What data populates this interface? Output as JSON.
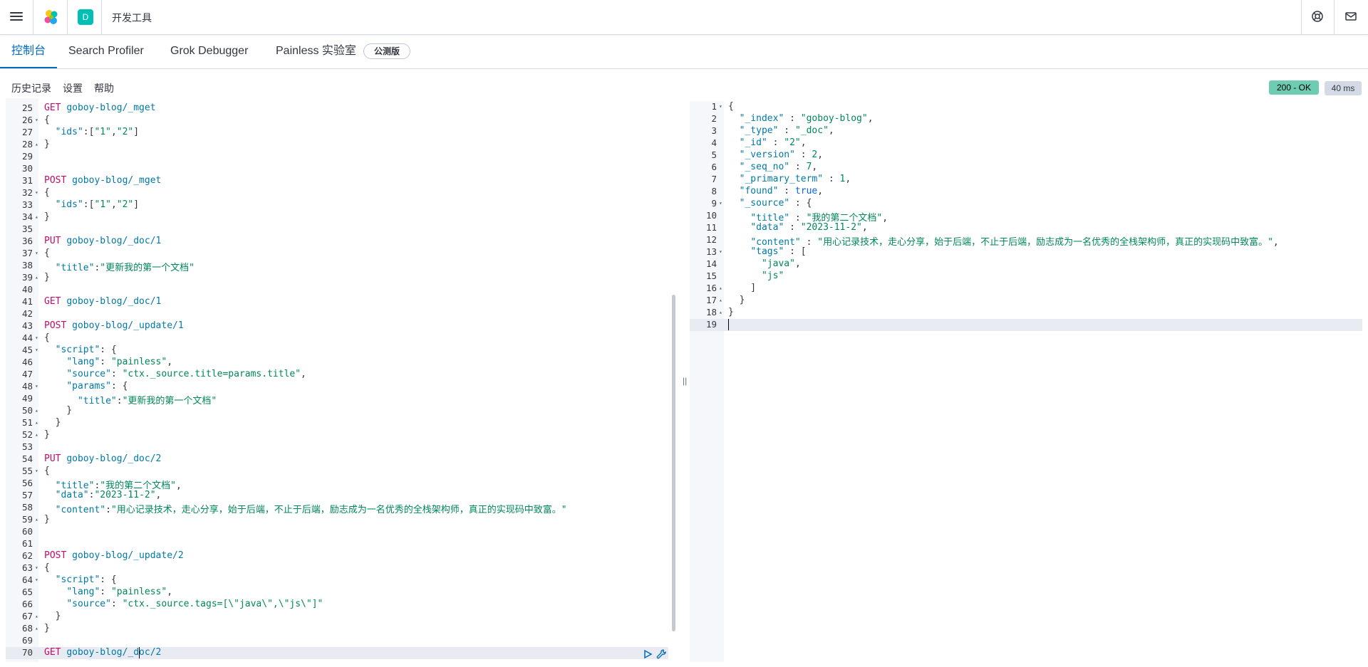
{
  "header": {
    "space_letter": "D",
    "title": "开发工具",
    "logo_icon": "elastic-logo-icon",
    "help_icon": "help-icon",
    "mail_icon": "newsfeed-icon"
  },
  "tabs": [
    {
      "label": "控制台",
      "active": true
    },
    {
      "label": "Search Profiler"
    },
    {
      "label": "Grok Debugger"
    },
    {
      "label": "Painless 实验室"
    }
  ],
  "beta_badge": "公测版",
  "toolbar": {
    "history": "历史记录",
    "settings": "设置",
    "help": "帮助"
  },
  "status": {
    "code": "200 - OK",
    "time": "40 ms",
    "color": "#6dccb1"
  },
  "request_lines": [
    {
      "n": "25",
      "fold": "",
      "tokens": [
        [
          "m",
          "GET "
        ],
        [
          "u",
          "goboy-blog/_mget"
        ]
      ]
    },
    {
      "n": "26",
      "fold": "open",
      "tokens": [
        [
          "p",
          "{"
        ]
      ]
    },
    {
      "n": "27",
      "fold": "",
      "tokens": [
        [
          "p",
          "  "
        ],
        [
          "k",
          "\"ids\""
        ],
        [
          "p",
          ":["
        ],
        [
          "s",
          "\"1\""
        ],
        [
          "p",
          ","
        ],
        [
          "s",
          "\"2\""
        ],
        [
          "p",
          "]"
        ]
      ]
    },
    {
      "n": "28",
      "fold": "close",
      "tokens": [
        [
          "p",
          "}"
        ]
      ]
    },
    {
      "n": "29",
      "fold": "",
      "tokens": []
    },
    {
      "n": "30",
      "fold": "",
      "tokens": []
    },
    {
      "n": "31",
      "fold": "",
      "tokens": [
        [
          "m",
          "POST "
        ],
        [
          "u",
          "goboy-blog/_mget"
        ]
      ]
    },
    {
      "n": "32",
      "fold": "open",
      "tokens": [
        [
          "p",
          "{"
        ]
      ]
    },
    {
      "n": "33",
      "fold": "",
      "tokens": [
        [
          "p",
          "  "
        ],
        [
          "k",
          "\"ids\""
        ],
        [
          "p",
          ":["
        ],
        [
          "s",
          "\"1\""
        ],
        [
          "p",
          ","
        ],
        [
          "s",
          "\"2\""
        ],
        [
          "p",
          "]"
        ]
      ]
    },
    {
      "n": "34",
      "fold": "close",
      "tokens": [
        [
          "p",
          "}"
        ]
      ]
    },
    {
      "n": "35",
      "fold": "",
      "tokens": []
    },
    {
      "n": "36",
      "fold": "",
      "tokens": [
        [
          "m",
          "PUT "
        ],
        [
          "u",
          "goboy-blog/_doc/1"
        ]
      ]
    },
    {
      "n": "37",
      "fold": "open",
      "tokens": [
        [
          "p",
          "{"
        ]
      ]
    },
    {
      "n": "38",
      "fold": "",
      "tokens": [
        [
          "p",
          "  "
        ],
        [
          "k",
          "\"title\""
        ],
        [
          "p",
          ":"
        ],
        [
          "s",
          "\"更新我的第一个文档\""
        ]
      ]
    },
    {
      "n": "39",
      "fold": "close",
      "tokens": [
        [
          "p",
          "}"
        ]
      ]
    },
    {
      "n": "40",
      "fold": "",
      "tokens": []
    },
    {
      "n": "41",
      "fold": "",
      "tokens": [
        [
          "m",
          "GET "
        ],
        [
          "u",
          "goboy-blog/_doc/1"
        ]
      ]
    },
    {
      "n": "42",
      "fold": "",
      "tokens": []
    },
    {
      "n": "43",
      "fold": "",
      "tokens": [
        [
          "m",
          "POST "
        ],
        [
          "u",
          "goboy-blog/_update/1"
        ]
      ]
    },
    {
      "n": "44",
      "fold": "open",
      "tokens": [
        [
          "p",
          "{"
        ]
      ]
    },
    {
      "n": "45",
      "fold": "open",
      "tokens": [
        [
          "p",
          "  "
        ],
        [
          "k",
          "\"script\""
        ],
        [
          "p",
          ": {"
        ]
      ]
    },
    {
      "n": "46",
      "fold": "",
      "tokens": [
        [
          "p",
          "    "
        ],
        [
          "k",
          "\"lang\""
        ],
        [
          "p",
          ": "
        ],
        [
          "s",
          "\"painless\""
        ],
        [
          "p",
          ","
        ]
      ]
    },
    {
      "n": "47",
      "fold": "",
      "tokens": [
        [
          "p",
          "    "
        ],
        [
          "k",
          "\"source\""
        ],
        [
          "p",
          ": "
        ],
        [
          "s",
          "\"ctx._source.title=params.title\""
        ],
        [
          "p",
          ","
        ]
      ]
    },
    {
      "n": "48",
      "fold": "open",
      "tokens": [
        [
          "p",
          "    "
        ],
        [
          "k",
          "\"params\""
        ],
        [
          "p",
          ": {"
        ]
      ]
    },
    {
      "n": "49",
      "fold": "",
      "tokens": [
        [
          "p",
          "      "
        ],
        [
          "k",
          "\"title\""
        ],
        [
          "p",
          ":"
        ],
        [
          "s",
          "\"更新我的第一个文档\""
        ]
      ]
    },
    {
      "n": "50",
      "fold": "close",
      "tokens": [
        [
          "p",
          "    }"
        ]
      ]
    },
    {
      "n": "51",
      "fold": "close",
      "tokens": [
        [
          "p",
          "  }"
        ]
      ]
    },
    {
      "n": "52",
      "fold": "close",
      "tokens": [
        [
          "p",
          "}"
        ]
      ]
    },
    {
      "n": "53",
      "fold": "",
      "tokens": []
    },
    {
      "n": "54",
      "fold": "",
      "tokens": [
        [
          "m",
          "PUT "
        ],
        [
          "u",
          "goboy-blog/_doc/2"
        ]
      ]
    },
    {
      "n": "55",
      "fold": "open",
      "tokens": [
        [
          "p",
          "{"
        ]
      ]
    },
    {
      "n": "56",
      "fold": "",
      "tokens": [
        [
          "p",
          "  "
        ],
        [
          "k",
          "\"title\""
        ],
        [
          "p",
          ":"
        ],
        [
          "s",
          "\"我的第二个文档\""
        ],
        [
          "p",
          ","
        ]
      ]
    },
    {
      "n": "57",
      "fold": "",
      "tokens": [
        [
          "p",
          "  "
        ],
        [
          "k",
          "\"data\""
        ],
        [
          "p",
          ":"
        ],
        [
          "s",
          "\"2023-11-2\""
        ],
        [
          "p",
          ","
        ]
      ]
    },
    {
      "n": "58",
      "fold": "",
      "tokens": [
        [
          "p",
          "  "
        ],
        [
          "k",
          "\"content\""
        ],
        [
          "p",
          ":"
        ],
        [
          "s",
          "\"用心记录技术，走心分享，始于后端，不止于后端，励志成为一名优秀的全栈架构师，真正的实现码中致富。\""
        ]
      ]
    },
    {
      "n": "59",
      "fold": "close",
      "tokens": [
        [
          "p",
          "}"
        ]
      ]
    },
    {
      "n": "60",
      "fold": "",
      "tokens": []
    },
    {
      "n": "61",
      "fold": "",
      "tokens": []
    },
    {
      "n": "62",
      "fold": "",
      "tokens": [
        [
          "m",
          "POST "
        ],
        [
          "u",
          "goboy-blog/_update/2"
        ]
      ]
    },
    {
      "n": "63",
      "fold": "open",
      "tokens": [
        [
          "p",
          "{"
        ]
      ]
    },
    {
      "n": "64",
      "fold": "open",
      "tokens": [
        [
          "p",
          "  "
        ],
        [
          "k",
          "\"script\""
        ],
        [
          "p",
          ": {"
        ]
      ]
    },
    {
      "n": "65",
      "fold": "",
      "tokens": [
        [
          "p",
          "    "
        ],
        [
          "k",
          "\"lang\""
        ],
        [
          "p",
          ": "
        ],
        [
          "s",
          "\"painless\""
        ],
        [
          "p",
          ","
        ]
      ]
    },
    {
      "n": "66",
      "fold": "",
      "tokens": [
        [
          "p",
          "    "
        ],
        [
          "k",
          "\"source\""
        ],
        [
          "p",
          ": "
        ],
        [
          "s",
          "\"ctx._source.tags=[\\\"java\\\",\\\"js\\\"]\""
        ]
      ]
    },
    {
      "n": "67",
      "fold": "close",
      "tokens": [
        [
          "p",
          "  }"
        ]
      ]
    },
    {
      "n": "68",
      "fold": "close",
      "tokens": [
        [
          "p",
          "}"
        ]
      ]
    },
    {
      "n": "69",
      "fold": "",
      "tokens": []
    },
    {
      "n": "70",
      "fold": "",
      "tokens": [
        [
          "m",
          "GET "
        ],
        [
          "u",
          "goboy-blog/_doc/2"
        ]
      ]
    }
  ],
  "response_lines": [
    {
      "n": "1",
      "fold": "open",
      "tokens": [
        [
          "p",
          "{"
        ]
      ]
    },
    {
      "n": "2",
      "fold": "",
      "tokens": [
        [
          "p",
          "  "
        ],
        [
          "k",
          "\"_index\""
        ],
        [
          "p",
          " : "
        ],
        [
          "s",
          "\"goboy-blog\""
        ],
        [
          "p",
          ","
        ]
      ]
    },
    {
      "n": "3",
      "fold": "",
      "tokens": [
        [
          "p",
          "  "
        ],
        [
          "k",
          "\"_type\""
        ],
        [
          "p",
          " : "
        ],
        [
          "s",
          "\"_doc\""
        ],
        [
          "p",
          ","
        ]
      ]
    },
    {
      "n": "4",
      "fold": "",
      "tokens": [
        [
          "p",
          "  "
        ],
        [
          "k",
          "\"_id\""
        ],
        [
          "p",
          " : "
        ],
        [
          "s",
          "\"2\""
        ],
        [
          "p",
          ","
        ]
      ]
    },
    {
      "n": "5",
      "fold": "",
      "tokens": [
        [
          "p",
          "  "
        ],
        [
          "k",
          "\"_version\""
        ],
        [
          "p",
          " : "
        ],
        [
          "n",
          "2"
        ],
        [
          "p",
          ","
        ]
      ]
    },
    {
      "n": "6",
      "fold": "",
      "tokens": [
        [
          "p",
          "  "
        ],
        [
          "k",
          "\"_seq_no\""
        ],
        [
          "p",
          " : "
        ],
        [
          "n",
          "7"
        ],
        [
          "p",
          ","
        ]
      ]
    },
    {
      "n": "7",
      "fold": "",
      "tokens": [
        [
          "p",
          "  "
        ],
        [
          "k",
          "\"_primary_term\""
        ],
        [
          "p",
          " : "
        ],
        [
          "n",
          "1"
        ],
        [
          "p",
          ","
        ]
      ]
    },
    {
      "n": "8",
      "fold": "",
      "tokens": [
        [
          "p",
          "  "
        ],
        [
          "k",
          "\"found\""
        ],
        [
          "p",
          " : "
        ],
        [
          "b",
          "true"
        ],
        [
          "p",
          ","
        ]
      ]
    },
    {
      "n": "9",
      "fold": "open",
      "tokens": [
        [
          "p",
          "  "
        ],
        [
          "k",
          "\"_source\""
        ],
        [
          "p",
          " : {"
        ]
      ]
    },
    {
      "n": "10",
      "fold": "",
      "tokens": [
        [
          "p",
          "    "
        ],
        [
          "k",
          "\"title\""
        ],
        [
          "p",
          " : "
        ],
        [
          "s",
          "\"我的第二个文档\""
        ],
        [
          "p",
          ","
        ]
      ]
    },
    {
      "n": "11",
      "fold": "",
      "tokens": [
        [
          "p",
          "    "
        ],
        [
          "k",
          "\"data\""
        ],
        [
          "p",
          " : "
        ],
        [
          "s",
          "\"2023-11-2\""
        ],
        [
          "p",
          ","
        ]
      ]
    },
    {
      "n": "12",
      "fold": "",
      "tokens": [
        [
          "p",
          "    "
        ],
        [
          "k",
          "\"content\""
        ],
        [
          "p",
          " : "
        ],
        [
          "s",
          "\"用心记录技术，走心分享，始于后端，不止于后端，励志成为一名优秀的全栈架构师，真正的实现码中致富。\""
        ],
        [
          "p",
          ","
        ]
      ]
    },
    {
      "n": "13",
      "fold": "open",
      "tokens": [
        [
          "p",
          "    "
        ],
        [
          "k",
          "\"tags\""
        ],
        [
          "p",
          " : ["
        ]
      ]
    },
    {
      "n": "14",
      "fold": "",
      "tokens": [
        [
          "p",
          "      "
        ],
        [
          "s",
          "\"java\""
        ],
        [
          "p",
          ","
        ]
      ]
    },
    {
      "n": "15",
      "fold": "",
      "tokens": [
        [
          "p",
          "      "
        ],
        [
          "s",
          "\"js\""
        ]
      ]
    },
    {
      "n": "16",
      "fold": "close",
      "tokens": [
        [
          "p",
          "    ]"
        ]
      ]
    },
    {
      "n": "17",
      "fold": "close",
      "tokens": [
        [
          "p",
          "  }"
        ]
      ]
    },
    {
      "n": "18",
      "fold": "close",
      "tokens": [
        [
          "p",
          "}"
        ]
      ]
    },
    {
      "n": "19",
      "fold": "",
      "tokens": []
    }
  ],
  "icons": {
    "run": "play-icon",
    "settings": "wrench-icon",
    "divider": "resize-handle-icon"
  }
}
